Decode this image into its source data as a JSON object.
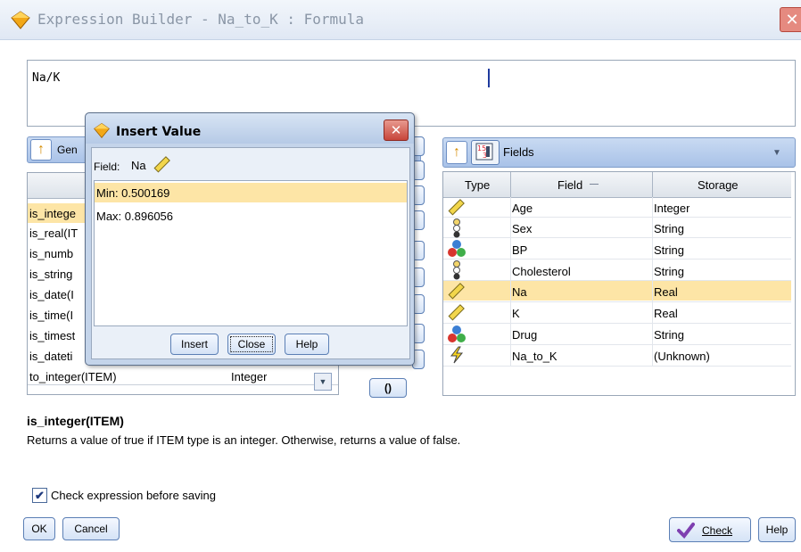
{
  "window": {
    "title": "Expression Builder - Na_to_K : Formula"
  },
  "expression": {
    "text": "Na/K"
  },
  "functions": {
    "group_label": "Gen",
    "rows": [
      {
        "name": "is_intege",
        "type": ""
      },
      {
        "name": "is_real(IT",
        "type": ""
      },
      {
        "name": "is_numb",
        "type": ""
      },
      {
        "name": "is_string",
        "type": ""
      },
      {
        "name": "is_date(I",
        "type": ""
      },
      {
        "name": "is_time(I",
        "type": ""
      },
      {
        "name": "is_timest",
        "type": ""
      },
      {
        "name": "is_dateti",
        "type": ""
      },
      {
        "name": "to_integer(ITEM)",
        "type": "Integer"
      }
    ]
  },
  "operators": {
    "parens": "()"
  },
  "fields_panel": {
    "title": "Fields",
    "columns": {
      "type": "Type",
      "field": "Field",
      "storage": "Storage"
    },
    "rows": [
      {
        "icon": "ruler-icon",
        "field": "Age",
        "storage": "Integer"
      },
      {
        "icon": "flag-icon",
        "field": "Sex",
        "storage": "String"
      },
      {
        "icon": "set-icon",
        "field": "BP",
        "storage": "String"
      },
      {
        "icon": "flag-icon",
        "field": "Cholesterol",
        "storage": "String"
      },
      {
        "icon": "ruler-icon",
        "field": "Na",
        "storage": "Real"
      },
      {
        "icon": "ruler-icon",
        "field": "K",
        "storage": "Real"
      },
      {
        "icon": "set-icon",
        "field": "Drug",
        "storage": "String"
      },
      {
        "icon": "lightning-icon",
        "field": "Na_to_K",
        "storage": "(Unknown)"
      }
    ],
    "selected_index": 4
  },
  "insert_value": {
    "title": "Insert Value",
    "field_label": "Field:",
    "field_name": "Na",
    "items": [
      "Min: 0.500169",
      "Max: 0.896056"
    ],
    "buttons": {
      "insert": "Insert",
      "close": "Close",
      "help": "Help"
    }
  },
  "description": {
    "func": "is_integer(ITEM)",
    "text": "Returns a value of true if ITEM type is an integer. Otherwise, returns a value of false."
  },
  "footer": {
    "check_expression": "Check expression before saving",
    "ok": "OK",
    "cancel": "Cancel",
    "check": "Check",
    "help": "Help"
  },
  "colors": {
    "accent": "#9bb3dd",
    "selection": "#fde5a6",
    "title_bar": "#e7eef8"
  }
}
